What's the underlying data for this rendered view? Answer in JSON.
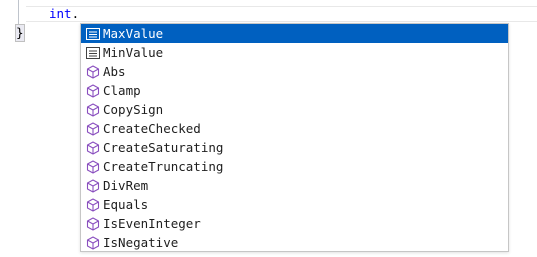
{
  "editor": {
    "keyword": "int",
    "punct": ".",
    "closing_brace": "}"
  },
  "completion": {
    "items": [
      {
        "label": "MaxValue",
        "icon": "field-icon",
        "selected": true
      },
      {
        "label": "MinValue",
        "icon": "field-icon",
        "selected": false
      },
      {
        "label": "Abs",
        "icon": "method-icon",
        "selected": false
      },
      {
        "label": "Clamp",
        "icon": "method-icon",
        "selected": false
      },
      {
        "label": "CopySign",
        "icon": "method-icon",
        "selected": false
      },
      {
        "label": "CreateChecked",
        "icon": "method-icon",
        "selected": false
      },
      {
        "label": "CreateSaturating",
        "icon": "method-icon",
        "selected": false
      },
      {
        "label": "CreateTruncating",
        "icon": "method-icon",
        "selected": false
      },
      {
        "label": "DivRem",
        "icon": "method-icon",
        "selected": false
      },
      {
        "label": "Equals",
        "icon": "method-icon",
        "selected": false
      },
      {
        "label": "IsEvenInteger",
        "icon": "method-icon",
        "selected": false
      },
      {
        "label": "IsNegative",
        "icon": "method-icon",
        "selected": false
      }
    ]
  },
  "colors": {
    "selection": "#0060c0",
    "keyword": "#0000ff",
    "method_icon": "#8a4fbf",
    "field_icon": "#424242"
  }
}
